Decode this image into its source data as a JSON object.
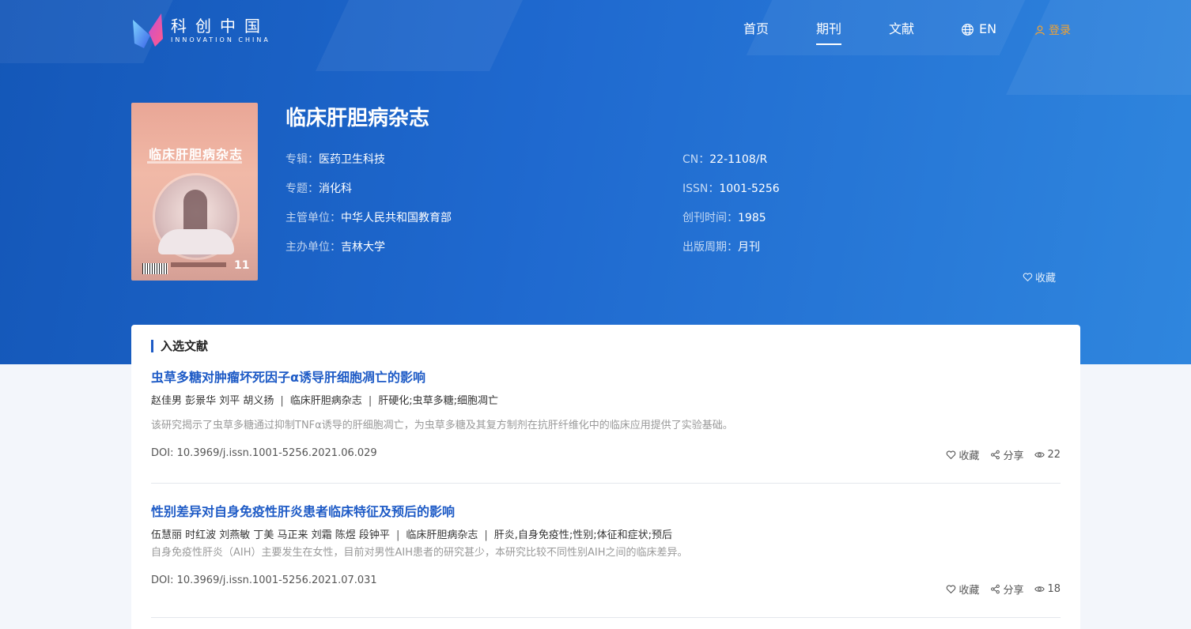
{
  "logo": {
    "cn": "科创中国",
    "en": "INNOVATION CHINA"
  },
  "nav": {
    "items": [
      {
        "label": "首页"
      },
      {
        "label": "期刊"
      },
      {
        "label": "文献"
      }
    ],
    "lang": "EN",
    "login": "登录"
  },
  "journal": {
    "cover_title": "临床肝胆病杂志",
    "cover_issue": "11",
    "title": "临床肝胆病杂志",
    "fields_left": [
      {
        "key": "专辑：",
        "value": "医药卫生科技"
      },
      {
        "key": "专题：",
        "value": "消化科"
      },
      {
        "key": "主管单位：",
        "value": "中华人民共和国教育部"
      },
      {
        "key": "主办单位：",
        "value": "吉林大学"
      }
    ],
    "fields_right": [
      {
        "key": "CN：",
        "value": "22-1108/R"
      },
      {
        "key": "ISSN：",
        "value": "1001-5256"
      },
      {
        "key": "创刊时间：",
        "value": "1985"
      },
      {
        "key": "出版周期：",
        "value": "月刊"
      }
    ],
    "favorite": "收藏"
  },
  "section": {
    "title": "入选文献",
    "articles": [
      {
        "title": "虫草多糖对肿瘤坏死因子α诱导肝细胞凋亡的影响",
        "authors": "赵佳男 彭景华 刘平 胡义扬",
        "journal": "临床肝胆病杂志",
        "keywords": "肝硬化;虫草多糖;细胞凋亡",
        "abstract": "该研究揭示了虫草多糖通过抑制TNFα诱导的肝细胞凋亡，为虫草多糖及其复方制剂在抗肝纤维化中的临床应用提供了实验基础。",
        "doi": "DOI: 10.3969/j.issn.1001-5256.2021.06.029",
        "favorite": "收藏",
        "share": "分享",
        "views": "22"
      },
      {
        "title": "性别差异对自身免疫性肝炎患者临床特征及预后的影响",
        "authors": "伍慧丽 时红波 刘燕敏 丁美 马正来 刘霜 陈煜 段钟平",
        "journal": "临床肝胆病杂志",
        "keywords": "肝炎,自身免疫性;性别;体征和症状;预后",
        "abstract": "自身免疫性肝炎（AIH）主要发生在女性，目前对男性AIH患者的研究甚少，本研究比较不同性别AIH之间的临床差异。",
        "doi": "DOI: 10.3969/j.issn.1001-5256.2021.07.031",
        "favorite": "收藏",
        "share": "分享",
        "views": "18"
      }
    ]
  },
  "colors": {
    "brand_blue": "#1e5bc6",
    "login_orange": "#f0a233"
  }
}
